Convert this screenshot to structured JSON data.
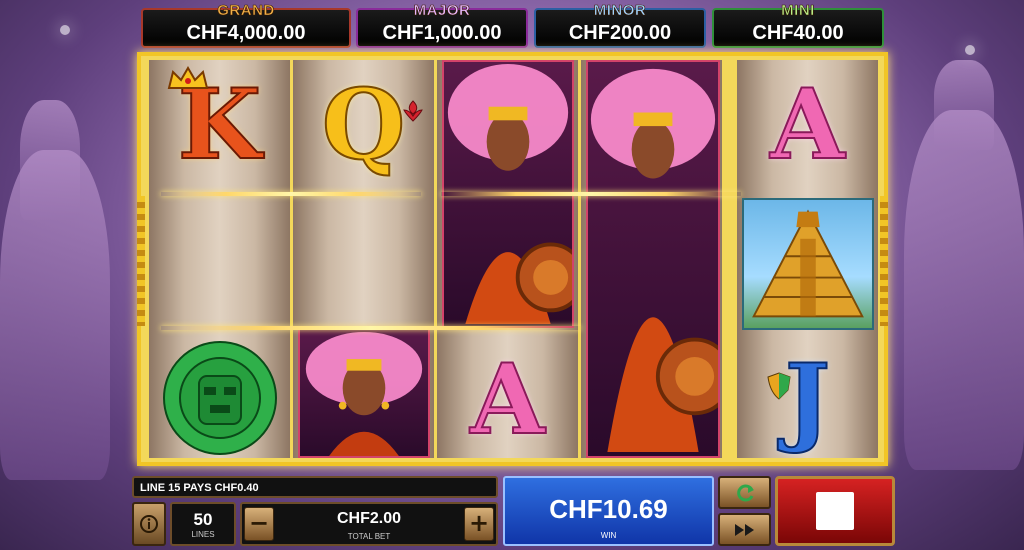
{
  "jackpots": {
    "grand": {
      "name": "GRAND",
      "value": "CHF4,000.00"
    },
    "major": {
      "name": "MAJOR",
      "value": "CHF1,000.00"
    },
    "minor": {
      "name": "MINOR",
      "value": "CHF200.00"
    },
    "mini": {
      "name": "MINI",
      "value": "CHF40.00"
    }
  },
  "reels": [
    {
      "symbols": [
        "K",
        "blank",
        "jade-mask"
      ]
    },
    {
      "symbols": [
        "Q",
        "blank",
        "warrior-woman"
      ]
    },
    {
      "symbols": [
        "warrior-woman (stacked)",
        "A"
      ]
    },
    {
      "symbols": [
        "warrior-woman (stacked full)"
      ]
    },
    {
      "symbols": [
        "A",
        "pyramid",
        "J"
      ]
    }
  ],
  "letters": {
    "K": "K",
    "Q": "Q",
    "A": "A",
    "J": "J"
  },
  "message": "LINE 15 PAYS CHF0.40",
  "lines": {
    "value": "50",
    "label": "LINES"
  },
  "bet": {
    "value": "CHF2.00",
    "label": "TOTAL BET",
    "minus": "−",
    "plus": "+"
  },
  "win": {
    "value": "CHF10.69",
    "label": "WIN"
  },
  "icons": {
    "info": "info-icon",
    "autoplay": "refresh-icon",
    "turbo": "fast-forward-icon",
    "spin": "stop-icon"
  },
  "colors": {
    "frame": "#f1c526",
    "win_panel": "#1f50c8",
    "spin_button": "#c41414",
    "jackpot_grand": "#a8382a",
    "jackpot_major": "#8a2b9a",
    "jackpot_minor": "#2c5fa3",
    "jackpot_mini": "#2f8f3a"
  }
}
